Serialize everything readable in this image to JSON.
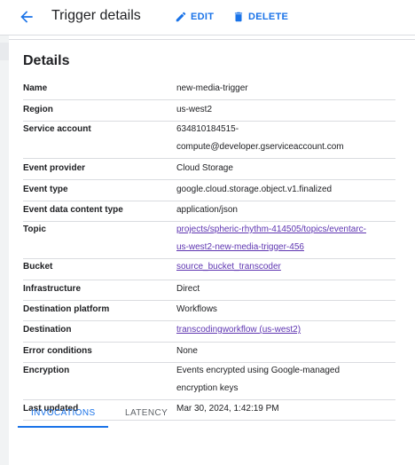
{
  "header": {
    "title": "Trigger details",
    "edit_label": "EDIT",
    "delete_label": "DELETE",
    "back_icon": "arrow-back-icon",
    "edit_icon": "pencil-icon",
    "delete_icon": "trash-icon"
  },
  "details": {
    "title": "Details",
    "rows": [
      {
        "label": "Name",
        "value": "new-media-trigger"
      },
      {
        "label": "Region",
        "value": "us-west2"
      },
      {
        "label": "Service account",
        "value_line1": "634810184515-",
        "value_line2": "compute@developer.gserviceaccount.com"
      },
      {
        "label": "Event provider",
        "value": "Cloud Storage"
      },
      {
        "label": "Event type",
        "value": "google.cloud.storage.object.v1.finalized"
      },
      {
        "label": "Event data content type",
        "value": "application/json"
      },
      {
        "label": "Topic",
        "value_line1": "projects/spheric-rhythm-414505/topics/eventarc-",
        "value_line2": "us-west2-new-media-trigger-456"
      },
      {
        "label": "Bucket",
        "value": "source_bucket_transcoder"
      },
      {
        "label": "Infrastructure",
        "value": "Direct"
      },
      {
        "label": "Destination platform",
        "value": "Workflows"
      },
      {
        "label": "Destination",
        "value": "transcodingworkflow (us-west2)"
      },
      {
        "label": "Error conditions",
        "value": "None"
      },
      {
        "label": "Encryption",
        "value_line1": "Events encrypted using Google-managed",
        "value_line2": "encryption keys"
      },
      {
        "label": "Last updated",
        "value": "Mar 30, 2024, 1:42:19 PM"
      }
    ]
  },
  "tabs": [
    {
      "label": "INVOCATIONS",
      "active": true
    },
    {
      "label": "LATENCY",
      "active": false
    }
  ],
  "colors": {
    "accent": "#1a73e8",
    "link": "#5e35b1",
    "divider": "#dadce0"
  }
}
